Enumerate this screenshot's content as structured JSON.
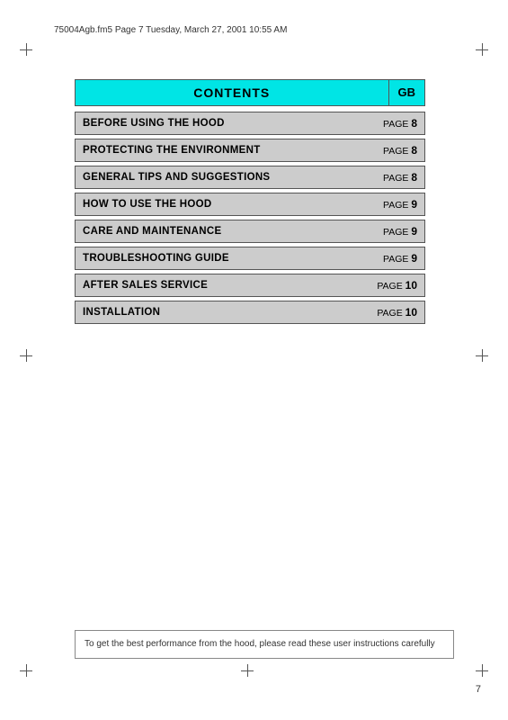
{
  "header": {
    "filename": "75004Agb.fm5  Page 7  Tuesday, March 27, 2001  10:55 AM"
  },
  "contents_block": {
    "title": "CONTENTS",
    "gb_label": "GB"
  },
  "toc_items": [
    {
      "label": "BEFORE USING THE HOOD",
      "page_prefix": "PAGE",
      "page_num": "8"
    },
    {
      "label": "PROTECTING THE ENVIRONMENT",
      "page_prefix": "PAGE",
      "page_num": "8"
    },
    {
      "label": "GENERAL TIPS AND SUGGESTIONS",
      "page_prefix": "PAGE",
      "page_num": "8"
    },
    {
      "label": "HOW TO USE THE HOOD",
      "page_prefix": "PAGE",
      "page_num": "9"
    },
    {
      "label": "CARE AND MAINTENANCE",
      "page_prefix": "PAGE",
      "page_num": "9"
    },
    {
      "label": "TROUBLESHOOTING GUIDE",
      "page_prefix": "PAGE",
      "page_num": "9"
    },
    {
      "label": "AFTER SALES SERVICE",
      "page_prefix": "PAGE",
      "page_num": "10"
    },
    {
      "label": "INSTALLATION",
      "page_prefix": "PAGE",
      "page_num": "10"
    }
  ],
  "footer_note": "To get the best performance from the hood, please read these user instructions carefully",
  "page_number": "7"
}
